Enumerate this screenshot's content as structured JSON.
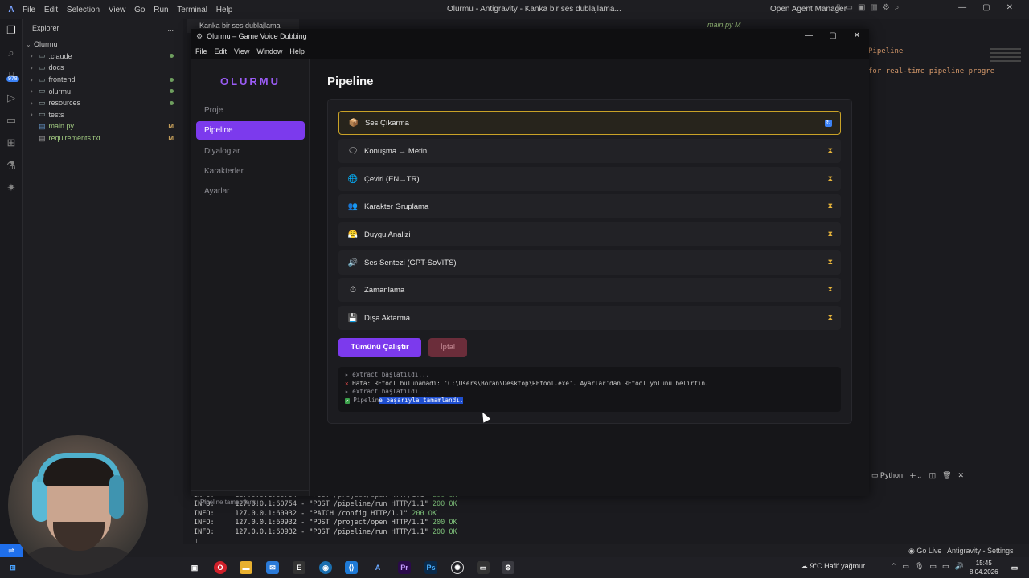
{
  "ide": {
    "menu": [
      "File",
      "Edit",
      "Selection",
      "View",
      "Go",
      "Run",
      "Terminal",
      "Help"
    ],
    "window_title": "Olurmu - Antigravity - Kanka bir ses dublajlama...",
    "agent_manager": "Open Agent Manager",
    "editor_tab": "Kanka bir ses dublajlama",
    "editor_tab2": "main.py M",
    "code_line1": "Pipeline",
    "code_line2": "for real-time pipeline progre",
    "explorer_title": "Explorer",
    "explorer_more": "...",
    "root_folder": "Olurmu",
    "tree": [
      {
        "label": ".claude",
        "kind": "folder",
        "marker": "dot"
      },
      {
        "label": "docs",
        "kind": "folder",
        "marker": ""
      },
      {
        "label": "frontend",
        "kind": "folder",
        "marker": "dot"
      },
      {
        "label": "olurmu",
        "kind": "folder",
        "marker": "dot"
      },
      {
        "label": "resources",
        "kind": "folder",
        "marker": "dot"
      },
      {
        "label": "tests",
        "kind": "folder",
        "marker": ""
      },
      {
        "label": "main.py",
        "kind": "file",
        "marker": "M"
      },
      {
        "label": "requirements.txt",
        "kind": "file",
        "marker": "M"
      }
    ],
    "badge": "978",
    "terminal_lang": "Python",
    "terminal_lines": [
      {
        "prefix": "INFO:",
        "addr": "127.0.0.1:60754",
        "req": "\"POST /project/open HTTP/1.1\"",
        "code": "200 OK"
      },
      {
        "prefix": "INFO:",
        "addr": "127.0.0.1:60754",
        "req": "\"POST /pipeline/run HTTP/1.1\"",
        "code": "200 OK"
      },
      {
        "prefix": "INFO:",
        "addr": "127.0.0.1:60932",
        "req": "\"PATCH /config HTTP/1.1\"",
        "code": "200 OK"
      },
      {
        "prefix": "INFO:",
        "addr": "127.0.0.1:60932",
        "req": "\"POST /project/open HTTP/1.1\"",
        "code": "200 OK"
      },
      {
        "prefix": "INFO:",
        "addr": "127.0.0.1:60932",
        "req": "\"POST /pipeline/run HTTP/1.1\"",
        "code": "200 OK"
      }
    ],
    "status_golive": "Go Live",
    "status_settings": "Antigravity - Settings"
  },
  "taskbar": {
    "weather": "9°C  Hafif yağmur",
    "time": "15:45",
    "date": "8.04.2026"
  },
  "app": {
    "window_title": "Olurmu – Game Voice Dubbing",
    "menu": [
      "File",
      "Edit",
      "View",
      "Window",
      "Help"
    ],
    "brand": "OLURMU",
    "nav": [
      {
        "label": "Proje",
        "active": false
      },
      {
        "label": "Pipeline",
        "active": true
      },
      {
        "label": "Diyaloglar",
        "active": false
      },
      {
        "label": "Karakterler",
        "active": false
      },
      {
        "label": "Ayarlar",
        "active": false
      }
    ],
    "sidebar_status": "Pipeline tamamlandı",
    "page_title": "Pipeline",
    "steps": [
      {
        "icon": "box-icon",
        "glyph": "📦",
        "label": "Ses Çıkarma",
        "status": "running"
      },
      {
        "icon": "speech-icon",
        "glyph": "🗨",
        "label": "Konuşma → Metin",
        "status": "pending"
      },
      {
        "icon": "globe-icon",
        "glyph": "🌐",
        "label": "Çeviri (EN→TR)",
        "status": "pending"
      },
      {
        "icon": "people-icon",
        "glyph": "👥",
        "label": "Karakter Gruplama",
        "status": "pending"
      },
      {
        "icon": "emotion-icon",
        "glyph": "😤",
        "label": "Duygu Analizi",
        "status": "pending"
      },
      {
        "icon": "speaker-icon",
        "glyph": "🔊",
        "label": "Ses Sentezi (GPT-SoVITS)",
        "status": "pending"
      },
      {
        "icon": "stopwatch-icon",
        "glyph": "⏱",
        "label": "Zamanlama",
        "status": "pending"
      },
      {
        "icon": "export-icon",
        "glyph": "💾",
        "label": "Dışa Aktarma",
        "status": "pending"
      }
    ],
    "run_all_label": "Tümünü Çalıştır",
    "cancel_label": "İptal",
    "log": {
      "line1": "▸ extract başlatıldı...",
      "line2": "Hata: REtool bulunamadı: 'C:\\Users\\Boran\\Desktop\\REtool.exe'. Ayarlar'dan REtool yolunu belirtin.",
      "line3": "▸ extract başlatıldı...",
      "line4_a": "Pipelin",
      "line4_b": "e başarıyla tamamlandı."
    }
  },
  "colors": {
    "accent": "#7c3aed",
    "active_step_border": "#c9a227",
    "pending_icon": "#e7b43a",
    "error": "#e24a4a",
    "success": "#3aa04a"
  }
}
